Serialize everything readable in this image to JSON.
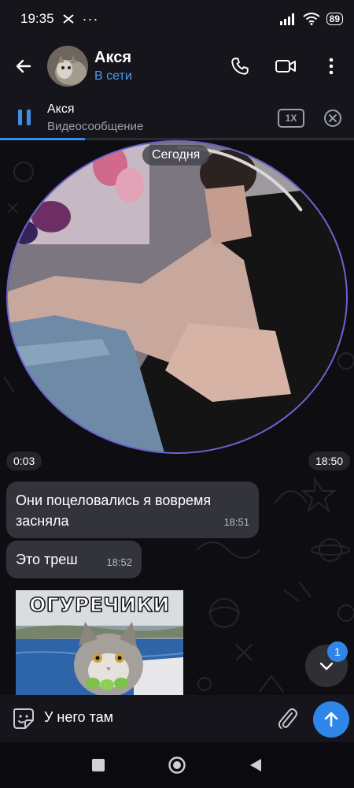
{
  "status_bar": {
    "time": "19:35",
    "battery": "89",
    "dots": "···"
  },
  "header": {
    "contact_name": "Акся",
    "contact_status": "В сети"
  },
  "player": {
    "title": "Акся",
    "subtitle": "Видеосообщение",
    "speed": "1X",
    "progress": 0.24
  },
  "chat": {
    "date_label": "Сегодня",
    "video_message": {
      "duration": "0:03",
      "time": "18:50",
      "playback_progress": 0.15
    },
    "messages": [
      {
        "text_line1": "Они поцеловались я вовремя",
        "text_line2": "засняла",
        "time": "18:51"
      },
      {
        "text": "Это треш",
        "time": "18:52"
      }
    ],
    "sticker": {
      "caption": "ОГУРЕЧИКИ"
    },
    "unread_count": "1"
  },
  "input": {
    "text": "У него там"
  },
  "colors": {
    "accent": "#2f86e8",
    "online": "#4a9cf0",
    "bubble": "#33333c",
    "video_ring": "#6d62d8"
  }
}
